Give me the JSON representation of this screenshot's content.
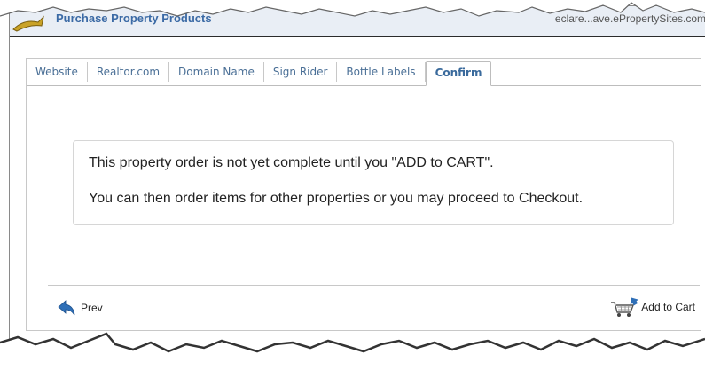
{
  "window": {
    "title": "Purchase Property Products",
    "url": "eclare...ave.ePropertySites.com"
  },
  "tabs": [
    {
      "label": "Website"
    },
    {
      "label": "Realtor.com"
    },
    {
      "label": "Domain Name"
    },
    {
      "label": "Sign Rider"
    },
    {
      "label": "Bottle Labels"
    },
    {
      "label": "Confirm",
      "active": true
    }
  ],
  "message": {
    "line1": "This property order is not yet complete until you \"ADD to CART\".",
    "line2": "You can then order items for other properties or you may proceed to Checkout."
  },
  "footer": {
    "prev_label": "Prev",
    "add_to_cart_label": "Add to Cart"
  },
  "colors": {
    "tab_text": "#4a6f96",
    "title_text": "#3b6aa5",
    "arrow_blue": "#2f6fb7"
  }
}
